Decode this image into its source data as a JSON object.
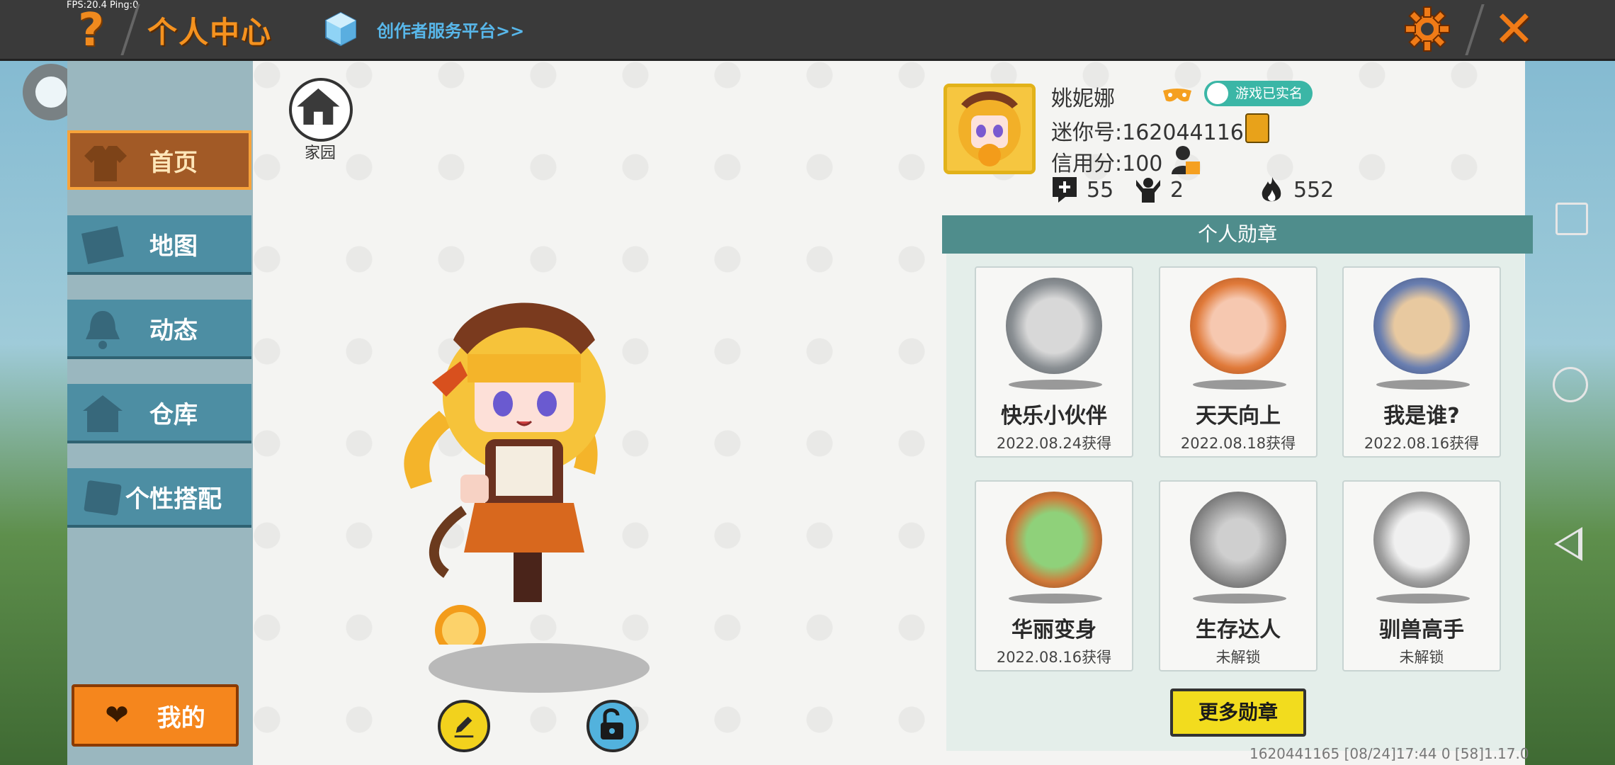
{
  "hud": {
    "fps": "FPS:20.4  Ping:0"
  },
  "header": {
    "help_icon": "?",
    "title": "个人中心",
    "creator_link": "创作者服务平台>>",
    "close_icon": "✕"
  },
  "sidebar": {
    "items": [
      {
        "label": "首页",
        "icon": "shirt-icon",
        "active": true
      },
      {
        "label": "地图",
        "icon": "map-icon",
        "active": false
      },
      {
        "label": "动态",
        "icon": "bell-icon",
        "active": false
      },
      {
        "label": "仓库",
        "icon": "warehouse-icon",
        "active": false
      },
      {
        "label": "个性搭配",
        "icon": "outfit-icon",
        "active": false
      }
    ],
    "mine_label": "我的",
    "mine_icon": "❤"
  },
  "home": {
    "label": "家园"
  },
  "profile": {
    "name": "姚妮娜",
    "verified_label": "游戏已实名",
    "mini_id": "迷你号:1620441165",
    "credit": "信用分:100",
    "stats": {
      "friends": "55",
      "fans": "2",
      "heat": "552"
    }
  },
  "medals": {
    "header": "个人勋章",
    "items": [
      {
        "name": "快乐小伙伴",
        "status": "2022.08.24获得",
        "color": "#8a8f93"
      },
      {
        "name": "天天向上",
        "status": "2022.08.18获得",
        "color": "#e07a3a"
      },
      {
        "name": "我是谁?",
        "status": "2022.08.16获得",
        "color": "#6a7fb0"
      },
      {
        "name": "华丽变身",
        "status": "2022.08.16获得",
        "color": "#d07a3a"
      },
      {
        "name": "生存达人",
        "status": "未解锁",
        "color": "#8b8b8b"
      },
      {
        "name": "驯兽高手",
        "status": "未解锁",
        "color": "#a0a0a0"
      }
    ],
    "more_label": "更多勋章"
  },
  "footer": {
    "text": "1620441165    [08/24]17:44 0   [58]1.17.0"
  },
  "colors": {
    "accent_orange": "#f5861d",
    "teal": "#4f8d8c",
    "yellow": "#f2dc1e"
  }
}
